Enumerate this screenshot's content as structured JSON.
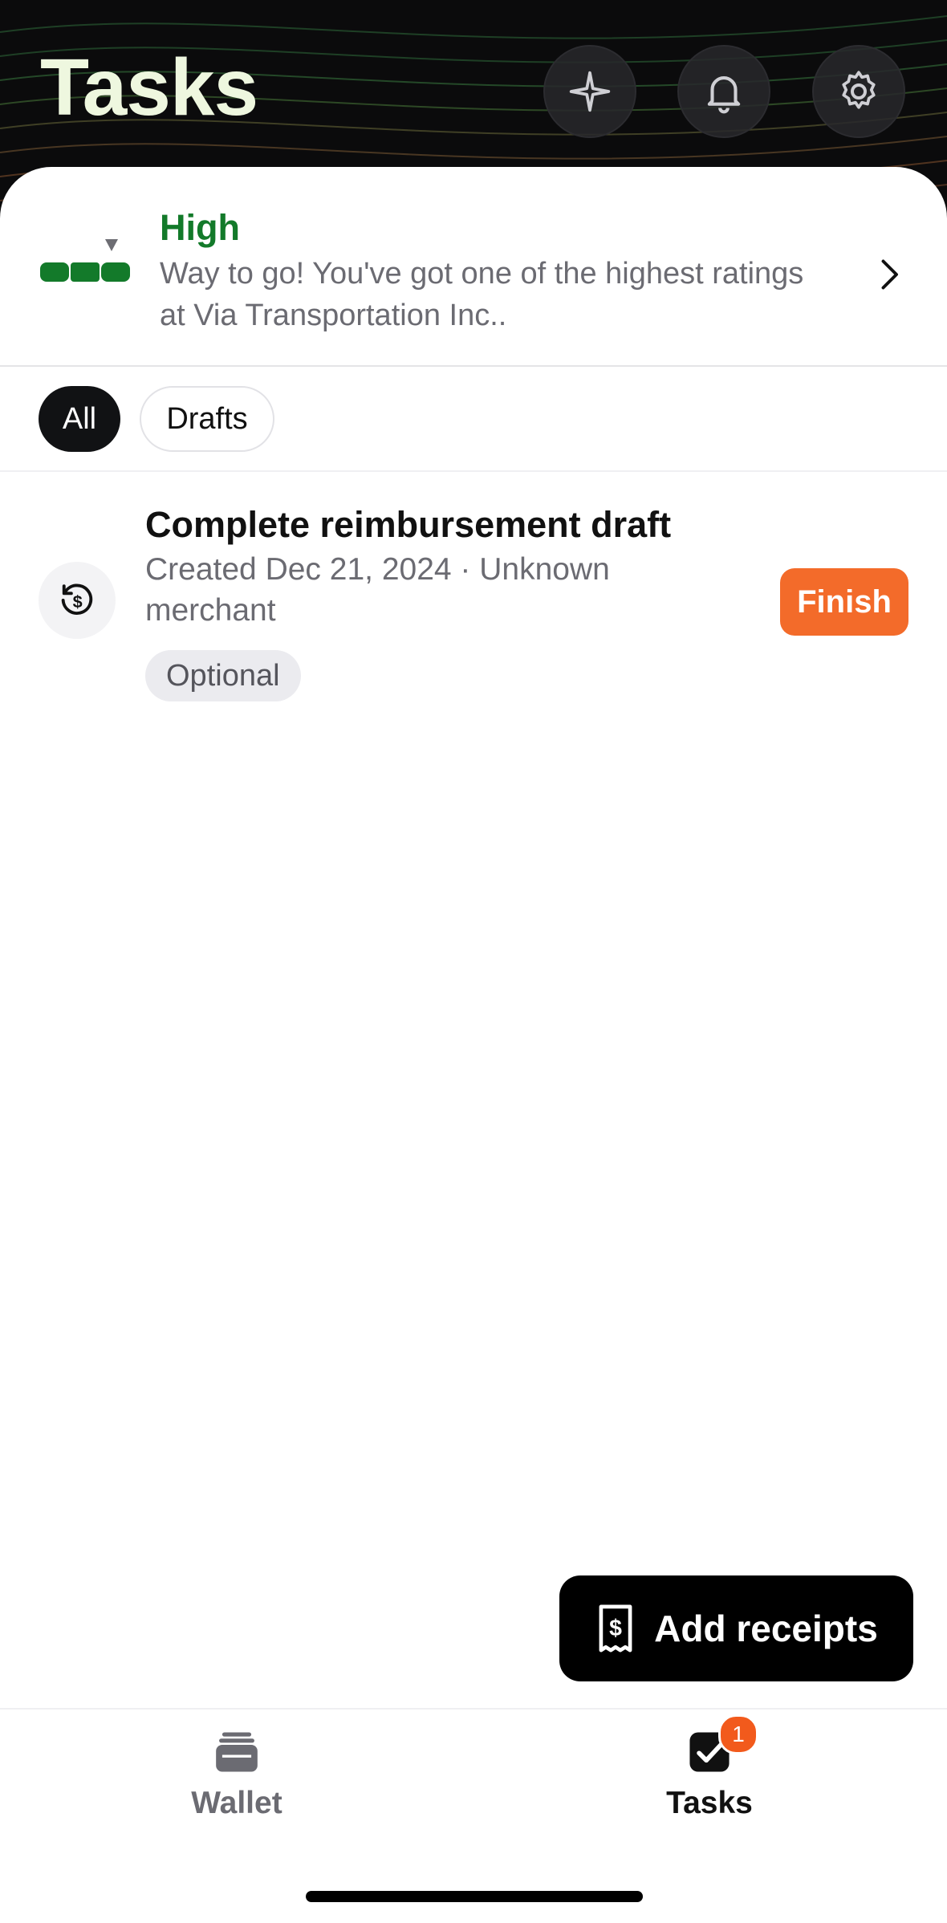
{
  "header": {
    "title": "Tasks",
    "icons": {
      "sparkle": "sparkle-icon",
      "bell": "bell-icon",
      "settings": "gear-icon"
    }
  },
  "rating": {
    "level": "High",
    "message": "Way to go! You've got one of the highest ratings at Via Transportation Inc..",
    "segments_filled": 3,
    "segments_total": 3,
    "color": "#137a2a"
  },
  "filters": {
    "items": [
      {
        "label": "All",
        "selected": true
      },
      {
        "label": "Drafts",
        "selected": false
      }
    ]
  },
  "tasks": [
    {
      "title": "Complete reimbursement draft",
      "subtitle": "Created Dec 21, 2024 · Unknown merchant",
      "tag": "Optional",
      "action": "Finish",
      "icon": "dollar-history-icon"
    }
  ],
  "fab": {
    "label": "Add receipts",
    "icon": "receipt-icon"
  },
  "tabbar": {
    "items": [
      {
        "label": "Wallet",
        "icon": "wallet-icon",
        "active": false
      },
      {
        "label": "Tasks",
        "icon": "checkbox-icon",
        "active": true,
        "badge": "1"
      }
    ]
  },
  "colors": {
    "accent": "#f36b2a",
    "badge": "#f25a1c",
    "header_bg": "#0b0b0c"
  }
}
